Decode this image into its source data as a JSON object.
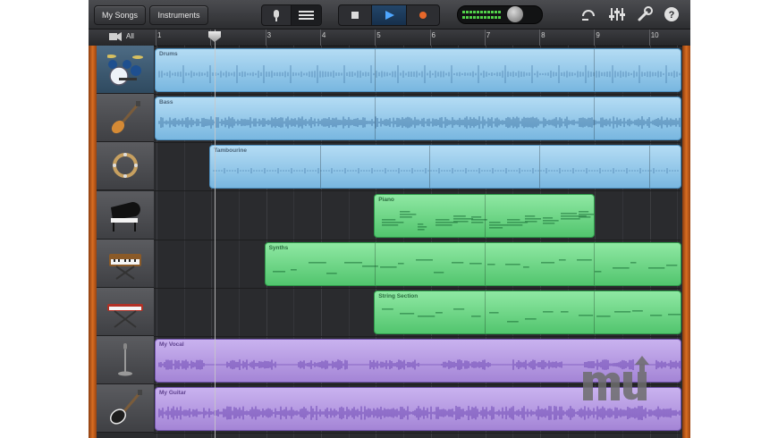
{
  "toolbar": {
    "my_songs": "My Songs",
    "instruments": "Instruments",
    "icons": [
      "mic-icon",
      "tracks-view-icon",
      "stop-icon",
      "play-icon",
      "record-icon",
      "loop-icon",
      "mixer-icon",
      "settings-icon",
      "help-icon"
    ]
  },
  "ruler": {
    "all_label": "All",
    "bars": [
      "1",
      "2",
      "3",
      "4",
      "5",
      "6",
      "7",
      "8",
      "9",
      "10"
    ]
  },
  "tracks": [
    {
      "name": "Drums",
      "icon": "drum-kit-icon",
      "color": "#8dc7ea"
    },
    {
      "name": "Bass",
      "icon": "bass-guitar-icon",
      "color": "#8dc7ea"
    },
    {
      "name": "Tambourine",
      "icon": "tambourine-icon",
      "color": "#8dc7ea"
    },
    {
      "name": "Piano",
      "icon": "grand-piano-icon",
      "color": "#6ad685"
    },
    {
      "name": "Synths",
      "icon": "synth-keyboard-icon",
      "color": "#6ad685"
    },
    {
      "name": "String Section",
      "icon": "keyboard-stand-icon",
      "color": "#6ad685"
    },
    {
      "name": "My Vocal",
      "icon": "microphone-stand-icon",
      "color": "#b49ae2"
    },
    {
      "name": "My Guitar",
      "icon": "electric-guitar-icon",
      "color": "#b49ae2"
    }
  ],
  "watermark": "mu"
}
